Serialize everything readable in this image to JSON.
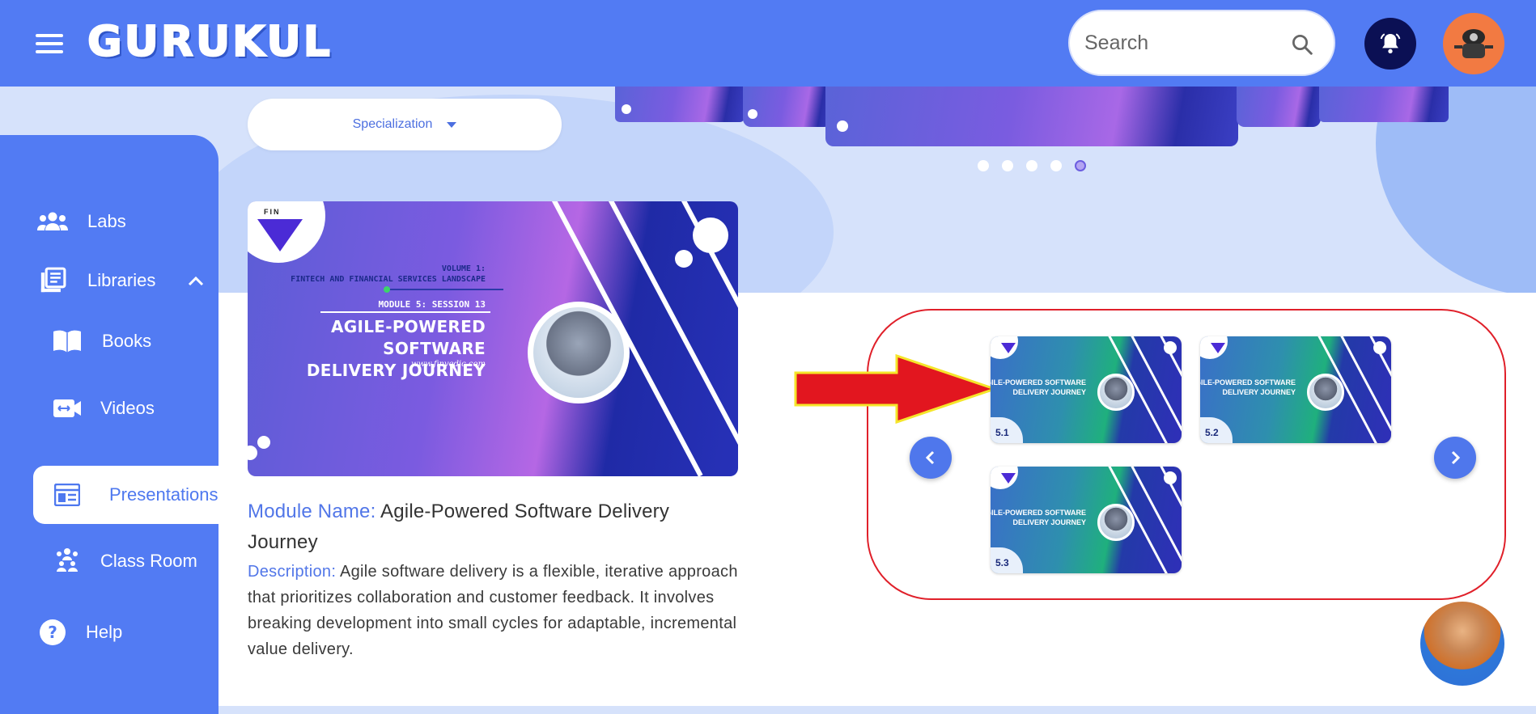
{
  "app": {
    "logo_text": "GURUKUL",
    "accent_color": "#527bf3"
  },
  "header": {
    "search_placeholder": "Search",
    "icons": [
      "menu-icon",
      "search-icon",
      "bell-icon",
      "user-avatar"
    ]
  },
  "filters": {
    "specialization_label": "Specialization"
  },
  "carousel": {
    "dot_count": 5,
    "active_dot": 5
  },
  "sidebar": {
    "items": [
      {
        "label": "Labs",
        "icon": "labs-icon"
      },
      {
        "label": "Libraries",
        "icon": "libraries-icon",
        "expanded": true
      },
      {
        "label": "Books",
        "icon": "book-icon"
      },
      {
        "label": "Videos",
        "icon": "video-icon"
      },
      {
        "label": "Presentations",
        "icon": "presentation-icon",
        "active": true
      },
      {
        "label": "Class Room",
        "icon": "classroom-icon"
      },
      {
        "label": "Help",
        "icon": "help-icon"
      }
    ]
  },
  "banner": {
    "brand": "FIN",
    "volume": "VOLUME 1:",
    "volume_title": "FINTECH AND FINANCIAL SERVICES LANDSCAPE",
    "module_session": "MODULE 5: SESSION 13",
    "title_line1": "AGILE-POWERED SOFTWARE",
    "title_line2": "DELIVERY JOURNEY",
    "website": "www.finvedic.com"
  },
  "module": {
    "name_label": "Module Name:",
    "name_value": "Agile-Powered Software Delivery Journey",
    "description_label": "Description:",
    "description_value": "Agile software delivery is a flexible, iterative approach that prioritizes collaboration and customer feedback. It involves breaking development into small cycles for adaptable, incremental value delivery."
  },
  "thumbnails": [
    {
      "number": "5.1",
      "title_line1": "AGILE-POWERED SOFTWARE",
      "title_line2": "DELIVERY JOURNEY"
    },
    {
      "number": "5.2",
      "title_line1": "AGILE-POWERED SOFTWARE",
      "title_line2": "DELIVERY JOURNEY"
    },
    {
      "number": "5.3",
      "title_line1": "AGILE-POWERED SOFTWARE",
      "title_line2": "DELIVERY JOURNEY"
    }
  ],
  "annotation_colors": {
    "highlight": "#e0202a",
    "arrow_outline": "#f5e52a"
  }
}
